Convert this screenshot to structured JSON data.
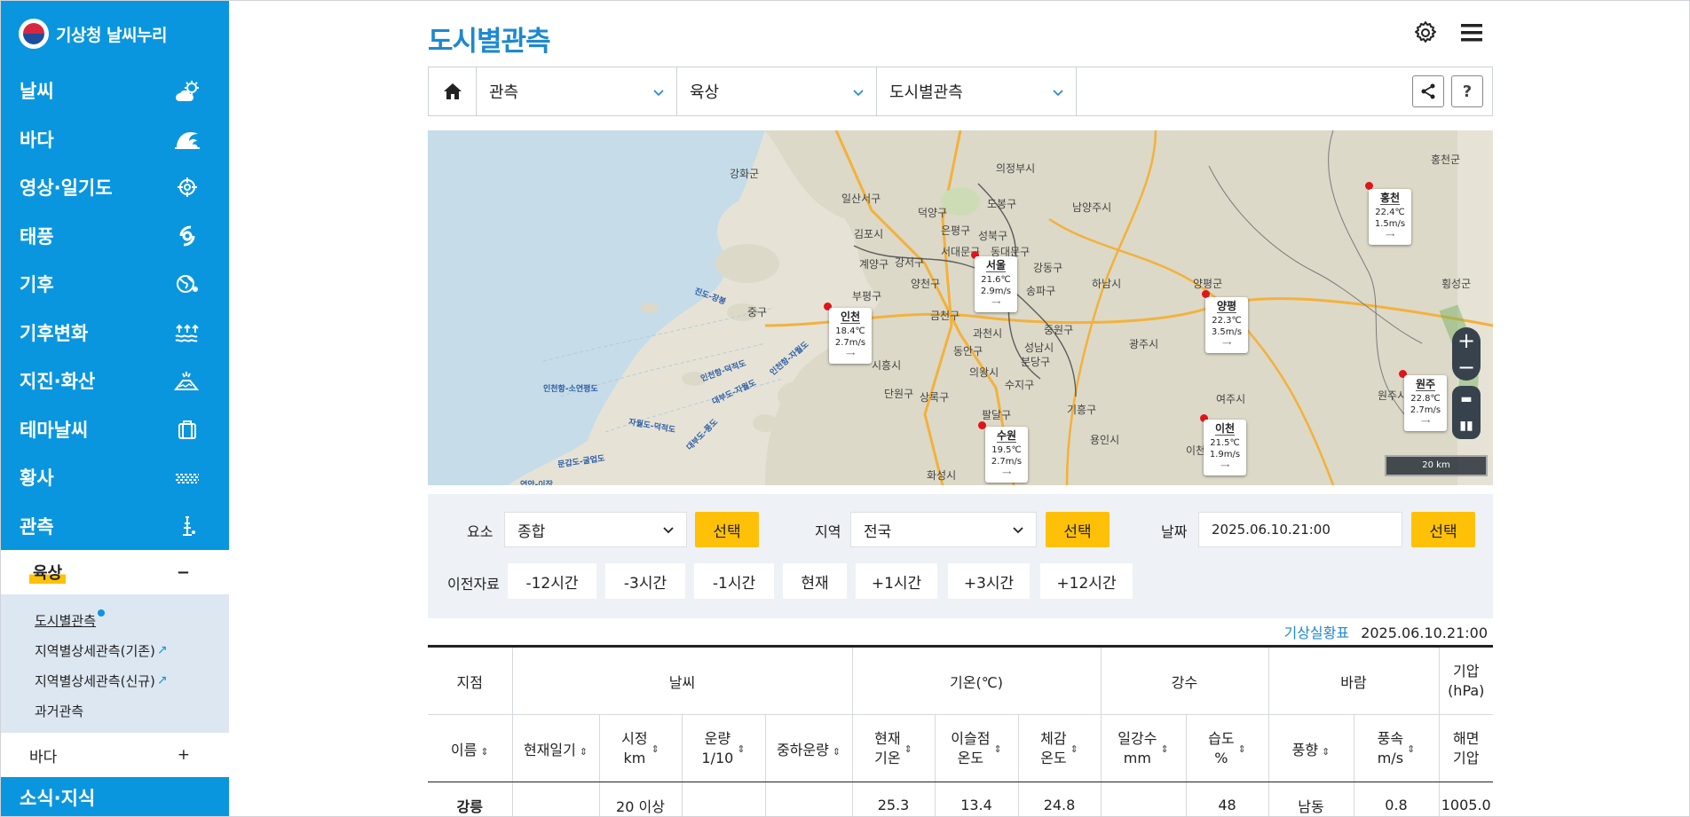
{
  "sidebar": {
    "logo": "기상청 날씨누리",
    "menu": [
      {
        "label": "날씨",
        "icon": "weather-icon"
      },
      {
        "label": "바다",
        "icon": "wave-icon"
      },
      {
        "label": "영상·일기도",
        "icon": "target-icon"
      },
      {
        "label": "태풍",
        "icon": "typhoon-icon"
      },
      {
        "label": "기후",
        "icon": "globe-icon"
      },
      {
        "label": "기후변화",
        "icon": "water-level-icon"
      },
      {
        "label": "지진·화산",
        "icon": "volcano-icon"
      },
      {
        "label": "테마날씨",
        "icon": "bag-icon"
      },
      {
        "label": "황사",
        "icon": "dust-icon"
      },
      {
        "label": "관측",
        "icon": "tower-icon"
      }
    ],
    "open_group": {
      "label": "육상",
      "toggle": "−"
    },
    "sub_items": [
      {
        "label": "도시별관측"
      },
      {
        "label": "지역별상세관측(기존)"
      },
      {
        "label": "지역별상세관측(신규)"
      },
      {
        "label": "과거관측"
      }
    ],
    "closed_group": {
      "label": "바다",
      "toggle": "+"
    },
    "next_item": "소식·지식"
  },
  "header": {
    "title": "도시별관측"
  },
  "breadcrumb": {
    "level1": "관측",
    "level2": "육상",
    "level3": "도시별관측",
    "help": "?"
  },
  "map": {
    "cities": [
      {
        "name": "서울",
        "temp": "21.6",
        "wind": "2.9"
      },
      {
        "name": "인천",
        "temp": "18.4",
        "wind": "2.7"
      },
      {
        "name": "양평",
        "temp": "22.3",
        "wind": "3.5"
      },
      {
        "name": "홍천",
        "temp": "22.4",
        "wind": "1.5"
      },
      {
        "name": "원주",
        "temp": "22.8",
        "wind": "2.7"
      },
      {
        "name": "이천",
        "temp": "21.5",
        "wind": "1.9"
      },
      {
        "name": "수원",
        "temp": "19.5",
        "wind": "2.7"
      }
    ],
    "temp_unit": "℃",
    "wind_unit": "m/s",
    "places": [
      "강화군",
      "의정부시",
      "홍천군",
      "일산서구",
      "덕양구",
      "도봉구",
      "남양주시",
      "김포시",
      "은평구",
      "성북구",
      "서대문구",
      "동대문구",
      "계양구",
      "강서구",
      "강동구",
      "하남시",
      "양평군",
      "부평구",
      "양천구",
      "송파구",
      "중구",
      "금천구",
      "과천시",
      "중원구",
      "광주시",
      "시흥시",
      "동안구",
      "성남시",
      "분당구",
      "단원구",
      "상록구",
      "의왕시",
      "수지구",
      "여주시",
      "원주시",
      "횡성군",
      "팔달구",
      "기흥구",
      "용인시",
      "화성시",
      "이천시"
    ],
    "sea_routes": [
      "인천항-소연평도",
      "진도-장봉",
      "인천항-덕적도",
      "대부도-자월도",
      "인천항-자월도",
      "자월도-덕적도",
      "대부도-풍도",
      "문갑도-굴업도",
      "연안-이작"
    ],
    "scale": "20 km",
    "zoom_in": "+",
    "zoom_out": "−"
  },
  "filter": {
    "element_label": "요소",
    "element_value": "종합",
    "select_btn": "선택",
    "region_label": "지역",
    "region_value": "전국",
    "date_label": "날짜",
    "date_value": "2025.06.10.21:00",
    "prev_label": "이전자료",
    "time_buttons": [
      "-12시간",
      "-3시간",
      "-1시간",
      "현재",
      "+1시간",
      "+3시간",
      "+12시간"
    ]
  },
  "status": {
    "link": "기상실황표",
    "time": "2025.06.10.21:00"
  },
  "table": {
    "groups": [
      "지점",
      "날씨",
      "기온(℃)",
      "강수",
      "바람",
      "기압\n(hPa)"
    ],
    "columns": [
      "이름",
      "현재일기",
      "시정\nkm",
      "운량\n1/10",
      "중하운량",
      "현재\n기온",
      "이슬점\n온도",
      "체감\n온도",
      "일강수\nmm",
      "습도\n%",
      "풍향",
      "풍속\nm/s",
      "해면\n기압"
    ],
    "rows": [
      [
        "강릉",
        "",
        "20 이상",
        "",
        "",
        "25.3",
        "13.4",
        "24.8",
        "",
        "48",
        "남동",
        "0.8",
        "1005.0"
      ]
    ]
  }
}
